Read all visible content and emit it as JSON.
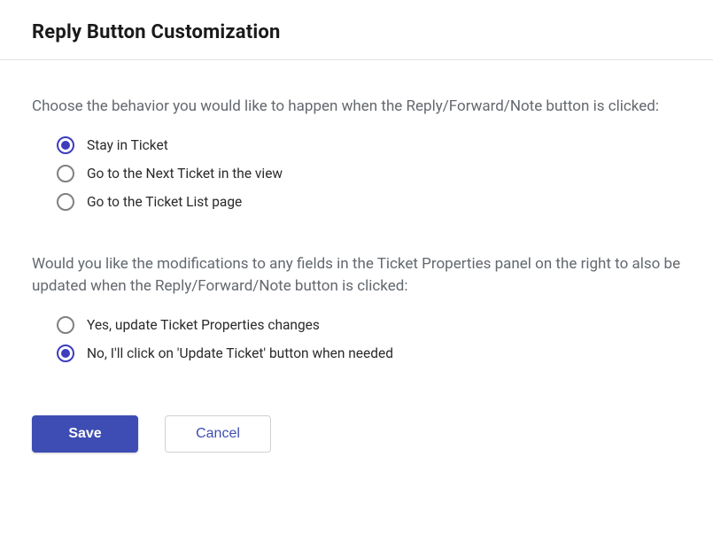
{
  "header": {
    "title": "Reply Button Customization"
  },
  "section1": {
    "question": "Choose the behavior you would like to happen when the Reply/Forward/Note button is clicked:",
    "options": [
      {
        "label": "Stay in Ticket",
        "selected": true
      },
      {
        "label": "Go to the Next Ticket in the view",
        "selected": false
      },
      {
        "label": "Go to the Ticket List page",
        "selected": false
      }
    ]
  },
  "section2": {
    "question": "Would you like the modifications to any fields in the Ticket Properties panel on the right to also be updated when the Reply/Forward/Note button is clicked:",
    "options": [
      {
        "label": "Yes, update Ticket Properties changes",
        "selected": false
      },
      {
        "label": "No, I'll click on 'Update Ticket' button when needed",
        "selected": true
      }
    ]
  },
  "buttons": {
    "save": "Save",
    "cancel": "Cancel"
  }
}
